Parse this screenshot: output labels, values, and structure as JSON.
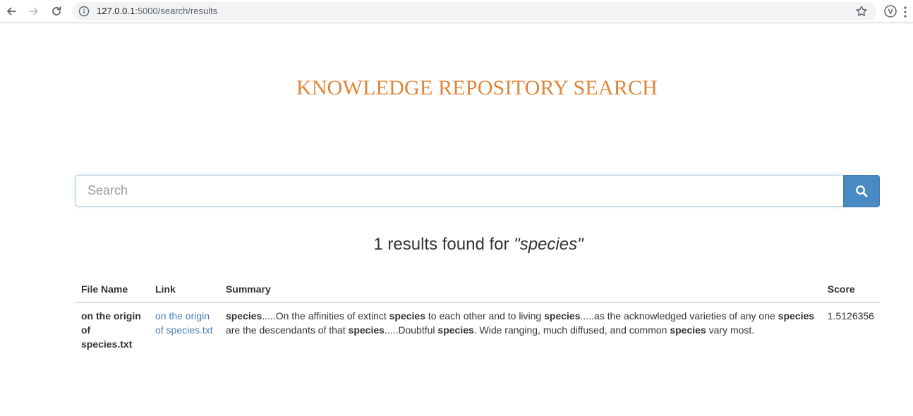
{
  "browser": {
    "url_host": "127.0.0.1",
    "url_rest": ":5000/search/results",
    "extension_letter": "V"
  },
  "page": {
    "title": "KNOWLEDGE REPOSITORY SEARCH"
  },
  "search": {
    "placeholder": "Search",
    "value": ""
  },
  "results": {
    "count_text": "1 results found for ",
    "query_text": "\"species\""
  },
  "table": {
    "headers": [
      "File Name",
      "Link",
      "Summary",
      "Score"
    ],
    "rows": [
      {
        "file_name": "on the origin of species.txt",
        "link_text": "on the origin of species.txt",
        "summary_segments": [
          {
            "text": "species",
            "bold": true
          },
          {
            "text": ".....On the affinities of extinct ",
            "bold": false
          },
          {
            "text": "species",
            "bold": true
          },
          {
            "text": " to each other and to living ",
            "bold": false
          },
          {
            "text": "species",
            "bold": true
          },
          {
            "text": ".....as the acknowledged varieties of any one ",
            "bold": false
          },
          {
            "text": "species",
            "bold": true
          },
          {
            "text": " are the descendants of that ",
            "bold": false
          },
          {
            "text": "species",
            "bold": true
          },
          {
            "text": ".....Doubtful ",
            "bold": false
          },
          {
            "text": "species",
            "bold": true
          },
          {
            "text": ". Wide ranging, much diffused, and common ",
            "bold": false
          },
          {
            "text": "species",
            "bold": true
          },
          {
            "text": " vary most.",
            "bold": false
          }
        ],
        "score": "1.5126356"
      }
    ]
  },
  "colors": {
    "title": "#e0863a",
    "search_button": "#4a8ac4",
    "link": "#4a7fb5"
  }
}
